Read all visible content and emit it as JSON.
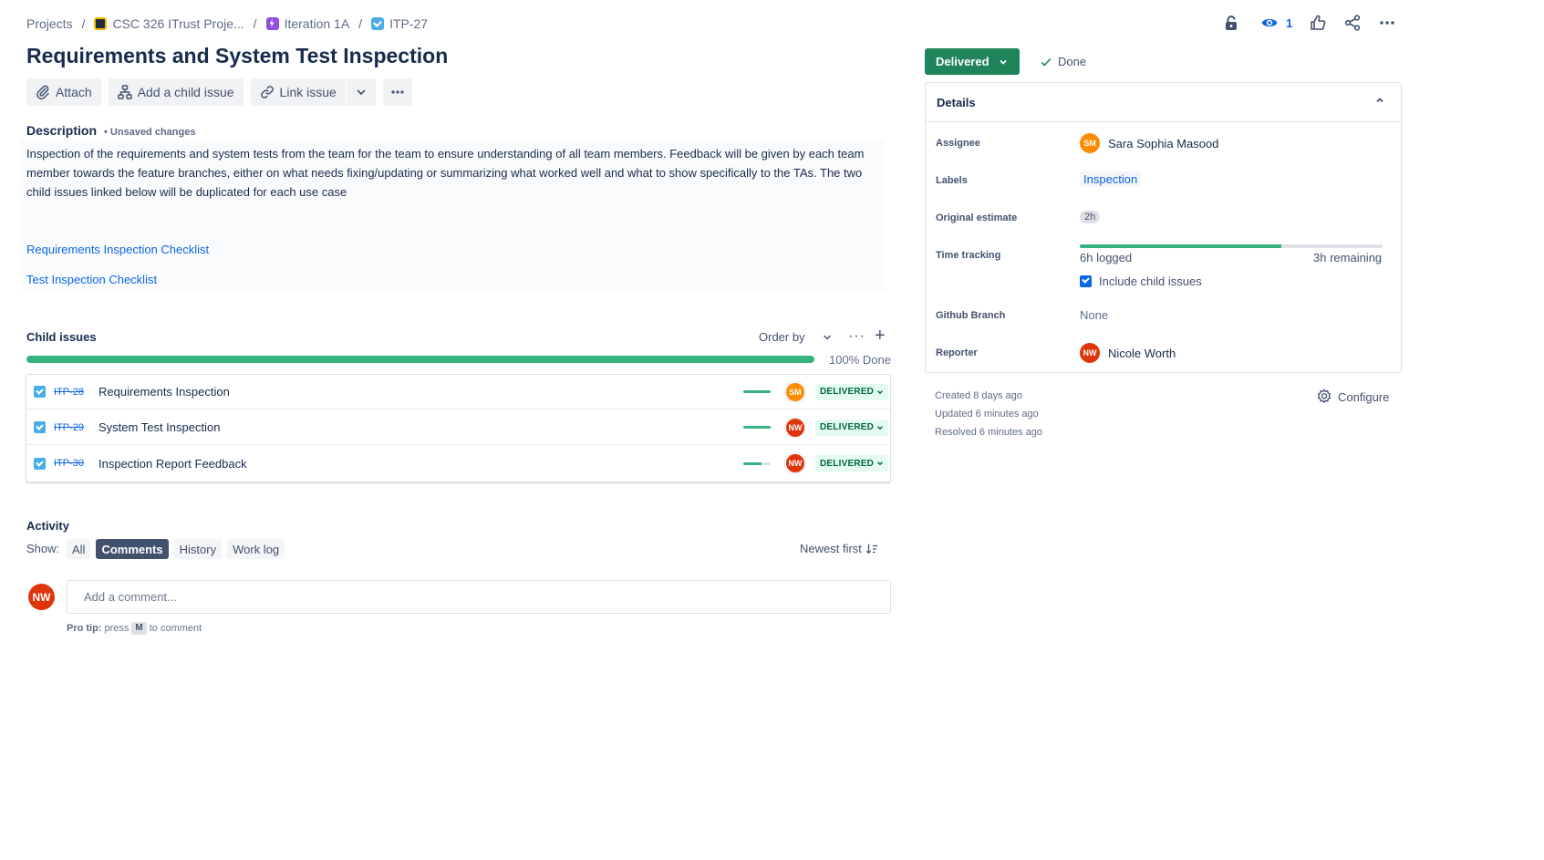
{
  "breadcrumb": {
    "projects": "Projects",
    "project": "CSC 326 ITrust Proje...",
    "epic": "Iteration 1A",
    "issue": "ITP-27",
    "separator": "/"
  },
  "issue": {
    "title": "Requirements and System Test Inspection"
  },
  "toolbar": {
    "attach": "Attach",
    "add_child": "Add a child issue",
    "link_issue": "Link issue"
  },
  "description": {
    "label": "Description",
    "unsaved": "• Unsaved changes",
    "text": "Inspection of the requirements and system tests from the team for the team to ensure understanding of all team members. Feedback will be given by each team member towards the feature branches, either on what needs fixing/updating or summarizing what worked well and what to show specifically to the TAs. The two child issues linked below will be duplicated for each use case",
    "links": [
      "Requirements Inspection Checklist",
      "Test Inspection Checklist"
    ]
  },
  "child_issues": {
    "label": "Child issues",
    "order_by": "Order by",
    "progress_done_fraction": 1.0,
    "progress_label": "100% Done",
    "items": [
      {
        "key": "ITP-28",
        "summary": "Requirements Inspection",
        "progress": 1.0,
        "assignee_initials": "SM",
        "assignee_color": "#ff8b00",
        "status": "DELIVERED"
      },
      {
        "key": "ITP-29",
        "summary": "System Test Inspection",
        "progress": 1.0,
        "assignee_initials": "NW",
        "assignee_color": "#de350b",
        "status": "DELIVERED"
      },
      {
        "key": "ITP-30",
        "summary": "Inspection Report Feedback",
        "progress": 0.67,
        "assignee_initials": "NW",
        "assignee_color": "#de350b",
        "status": "DELIVERED"
      }
    ]
  },
  "activity": {
    "label": "Activity",
    "show": "Show:",
    "filters": [
      "All",
      "Comments",
      "History",
      "Work log"
    ],
    "active_filter": "Comments",
    "sort": "Newest first",
    "user_initials": "NW",
    "comment_placeholder": "Add a comment...",
    "protip_bold": "Pro tip:",
    "protip_press": "press",
    "protip_key": "M",
    "protip_rest": "to comment"
  },
  "top_actions": {
    "watch_count": "1",
    "icons": [
      "lock-icon",
      "eye-icon",
      "thumbs-up-icon",
      "share-icon",
      "more-icon"
    ]
  },
  "status": {
    "current": "Delivered",
    "resolution": "Done",
    "color": "#1f845a"
  },
  "details": {
    "header": "Details",
    "assignee_label": "Assignee",
    "assignee_name": "Sara Sophia Masood",
    "assignee_initials": "SM",
    "labels_label": "Labels",
    "labels_value": "Inspection",
    "estimate_label": "Original estimate",
    "estimate_value": "2h",
    "time_label": "Time tracking",
    "time_logged": "6h logged",
    "time_remaining": "3h remaining",
    "time_logged_fraction": 0.667,
    "include_child": "Include child issues",
    "include_child_checked": true,
    "github_label": "Github Branch",
    "github_value": "None",
    "reporter_label": "Reporter",
    "reporter_name": "Nicole Worth",
    "reporter_initials": "NW"
  },
  "meta": {
    "created": "Created 8 days ago",
    "updated": "Updated 6 minutes ago",
    "resolved": "Resolved 6 minutes ago",
    "configure": "Configure"
  }
}
